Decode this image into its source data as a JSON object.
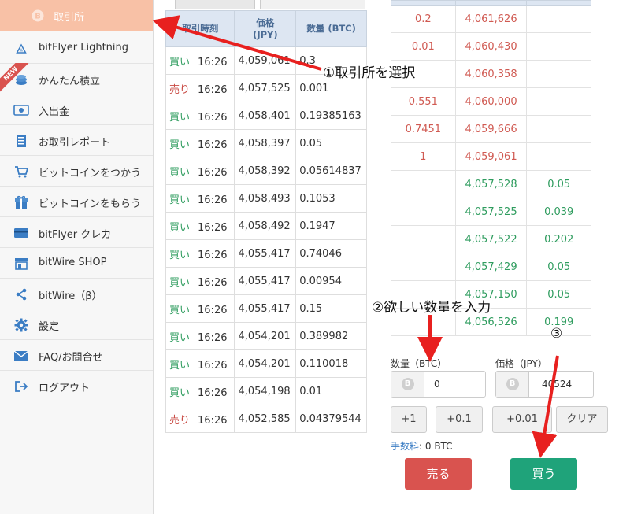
{
  "sidebar": {
    "items": [
      {
        "label": "取引所",
        "icon": "bitcoin-coin-icon"
      },
      {
        "label": "bitFlyer Lightning",
        "icon": "lightning-triangle-icon"
      },
      {
        "label": "かんたん積立",
        "icon": "coin-stack-icon"
      },
      {
        "label": "入出金",
        "icon": "cash-icon"
      },
      {
        "label": "お取引レポート",
        "icon": "document-icon"
      },
      {
        "label": "ビットコインをつかう",
        "icon": "cart-icon"
      },
      {
        "label": "ビットコインをもらう",
        "icon": "gift-icon"
      },
      {
        "label": "bitFlyer クレカ",
        "icon": "credit-card-icon"
      },
      {
        "label": "bitWire SHOP",
        "icon": "shop-icon"
      },
      {
        "label": "bitWire（β）",
        "icon": "share-icon"
      },
      {
        "label": "設定",
        "icon": "gear-icon"
      },
      {
        "label": "FAQ/お問合せ",
        "icon": "mail-icon"
      },
      {
        "label": "ログアウト",
        "icon": "logout-icon"
      }
    ],
    "new_badge": "NEW"
  },
  "trades": {
    "headers": [
      "取引時刻",
      "価格\n(JPY)",
      "数量 (BTC)"
    ],
    "rows": [
      {
        "side": "買い",
        "time": "16:26",
        "price": "4,059,061",
        "qty": "0.3"
      },
      {
        "side": "売り",
        "time": "16:26",
        "price": "4,057,525",
        "qty": "0.001"
      },
      {
        "side": "買い",
        "time": "16:26",
        "price": "4,058,401",
        "qty": "0.19385163"
      },
      {
        "side": "買い",
        "time": "16:26",
        "price": "4,058,397",
        "qty": "0.05"
      },
      {
        "side": "買い",
        "time": "16:26",
        "price": "4,058,392",
        "qty": "0.05614837"
      },
      {
        "side": "買い",
        "time": "16:26",
        "price": "4,058,493",
        "qty": "0.1053"
      },
      {
        "side": "買い",
        "time": "16:26",
        "price": "4,058,492",
        "qty": "0.1947"
      },
      {
        "side": "買い",
        "time": "16:26",
        "price": "4,055,417",
        "qty": "0.74046"
      },
      {
        "side": "買い",
        "time": "16:26",
        "price": "4,055,417",
        "qty": "0.00954"
      },
      {
        "side": "買い",
        "time": "16:26",
        "price": "4,055,417",
        "qty": "0.15"
      },
      {
        "side": "買い",
        "time": "16:26",
        "price": "4,054,201",
        "qty": "0.389982"
      },
      {
        "side": "買い",
        "time": "16:26",
        "price": "4,054,201",
        "qty": "0.110018"
      },
      {
        "side": "買い",
        "time": "16:26",
        "price": "4,054,198",
        "qty": "0.01"
      },
      {
        "side": "売り",
        "time": "16:26",
        "price": "4,052,585",
        "qty": "0.04379544"
      }
    ]
  },
  "order_book": {
    "asks": [
      {
        "size": "0.2",
        "price": "4,061,626"
      },
      {
        "size": "0.01",
        "price": "4,060,430"
      },
      {
        "size": "",
        "price": "4,060,358"
      },
      {
        "size": "0.551",
        "price": "4,060,000"
      },
      {
        "size": "0.7451",
        "price": "4,059,666"
      },
      {
        "size": "1",
        "price": "4,059,061"
      }
    ],
    "bids": [
      {
        "price": "4,057,528",
        "size": "0.05"
      },
      {
        "price": "4,057,525",
        "size": "0.039"
      },
      {
        "price": "4,057,522",
        "size": "0.202"
      },
      {
        "price": "4,057,429",
        "size": "0.05"
      },
      {
        "price": "4,057,150",
        "size": "0.05"
      },
      {
        "price": "4,056,526",
        "size": "0.199"
      }
    ]
  },
  "order_form": {
    "qty_label": "数量（BTC）",
    "qty_value": "0",
    "price_label": "価格（JPY）",
    "price_value": "40524",
    "quick_buttons": [
      "+1",
      "+0.1",
      "+0.01",
      "クリア"
    ],
    "fee_label": "手数料",
    "fee_value": ": 0 BTC",
    "sell_label": "売る",
    "buy_label": "買う"
  },
  "annotations": {
    "step1": "①取引所を選択",
    "step2": "②欲しい数量を入力",
    "step3": "③"
  },
  "colors": {
    "active_item": "#f8c1a6",
    "buy": "#2e9c5e",
    "sell": "#c94a43",
    "sell_button": "#d9534f",
    "buy_button": "#1fa37a",
    "arrow": "#e8201f"
  }
}
